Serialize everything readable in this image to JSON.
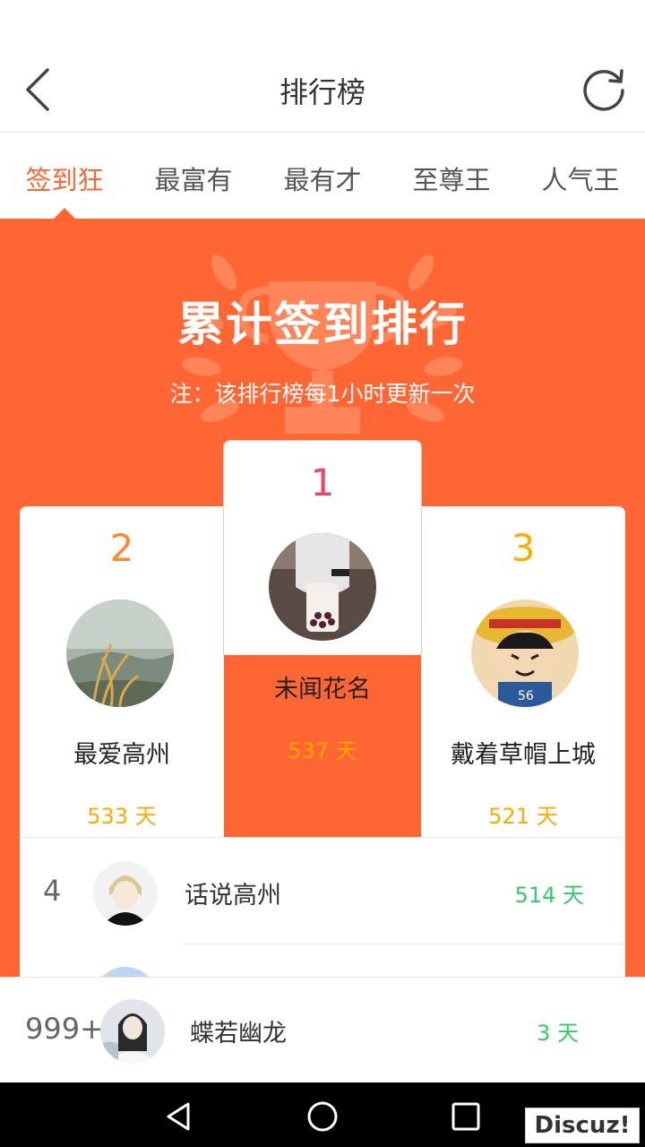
{
  "header": {
    "title": "排行榜"
  },
  "tabs": [
    {
      "label": "签到狂",
      "active": true
    },
    {
      "label": "最富有",
      "active": false
    },
    {
      "label": "最有才",
      "active": false
    },
    {
      "label": "至尊王",
      "active": false
    },
    {
      "label": "人气王",
      "active": false
    }
  ],
  "banner": {
    "title": "累计签到排行",
    "note": "注：该排行榜每1小时更新一次"
  },
  "podium": {
    "first": {
      "rank": "1",
      "name": "未闻花名",
      "days": "537 天"
    },
    "second": {
      "rank": "2",
      "name": "最爱高州",
      "days": "533 天"
    },
    "third": {
      "rank": "3",
      "name": "戴着草帽上城",
      "days": "521 天"
    }
  },
  "list": [
    {
      "rank": "4",
      "name": "话说高州",
      "days": "514 天"
    }
  ],
  "my_rank": {
    "rank": "999+",
    "name": "蝶若幽龙",
    "days": "3 天"
  },
  "watermark": "Discuz!",
  "colors": {
    "accent": "#ff6633",
    "gold": "#ffaa00",
    "green": "#33cc66",
    "first_rank": "#ee4466",
    "second_rank": "#ff8833",
    "third_rank": "#ffaa00"
  }
}
